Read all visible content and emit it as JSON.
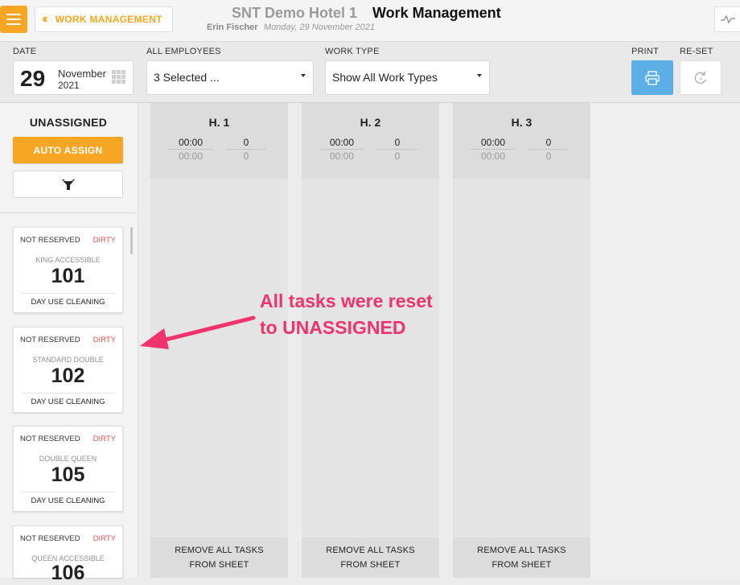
{
  "header": {
    "back_label": "WORK MANAGEMENT",
    "hotel_name": "SNT Demo Hotel 1",
    "page_title": "Work Management",
    "user_name": "Erin Fischer",
    "date_text": "Monday, 29 November 2021"
  },
  "filters": {
    "date_label": "DATE",
    "date_day": "29",
    "date_month": "November",
    "date_year": "2021",
    "employees_label": "ALL EMPLOYEES",
    "employees_value": "3 Selected ...",
    "worktype_label": "WORK TYPE",
    "worktype_value": "Show All Work Types",
    "print_label": "PRINT",
    "reset_label": "RE-SET"
  },
  "unassigned": {
    "title": "UNASSIGNED",
    "auto_assign_label": "AUTO ASSIGN",
    "cards": [
      {
        "reservation": "NOT RESERVED",
        "status": "DIRTY",
        "room_type": "KING ACCESSIBLE",
        "room_number": "101",
        "task": "DAY USE CLEANING"
      },
      {
        "reservation": "NOT RESERVED",
        "status": "DIRTY",
        "room_type": "STANDARD DOUBLE",
        "room_number": "102",
        "task": "DAY USE CLEANING"
      },
      {
        "reservation": "NOT RESERVED",
        "status": "DIRTY",
        "room_type": "DOUBLE QUEEN",
        "room_number": "105",
        "task": "DAY USE CLEANING"
      },
      {
        "reservation": "NOT RESERVED",
        "status": "DIRTY",
        "room_type": "QUEEN ACCESSIBLE",
        "room_number": "106",
        "task": ""
      }
    ]
  },
  "columns": [
    {
      "name": "H. 1",
      "time_assigned": "00:00",
      "time_done": "00:00",
      "count_assigned": "0",
      "count_done": "0",
      "footer_line1": "REMOVE ALL TASKS",
      "footer_line2": "FROM SHEET"
    },
    {
      "name": "H. 2",
      "time_assigned": "00:00",
      "time_done": "00:00",
      "count_assigned": "0",
      "count_done": "0",
      "footer_line1": "REMOVE ALL TASKS",
      "footer_line2": "FROM SHEET"
    },
    {
      "name": "H. 3",
      "time_assigned": "00:00",
      "time_done": "00:00",
      "count_assigned": "0",
      "count_done": "0",
      "footer_line1": "REMOVE ALL TASKS",
      "footer_line2": "FROM SHEET"
    }
  ],
  "annotation": {
    "line1": "All tasks were reset",
    "line2": "to UNASSIGNED",
    "color": "#f0336a"
  },
  "colors": {
    "accent": "#f6a623",
    "print": "#5baee6",
    "dirty": "#d9534f"
  }
}
